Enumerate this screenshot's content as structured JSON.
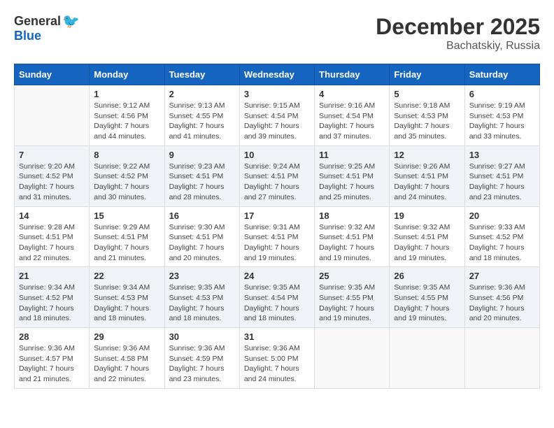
{
  "logo": {
    "general": "General",
    "blue": "Blue"
  },
  "title": "December 2025",
  "location": "Bachatskiy, Russia",
  "days_of_week": [
    "Sunday",
    "Monday",
    "Tuesday",
    "Wednesday",
    "Thursday",
    "Friday",
    "Saturday"
  ],
  "weeks": [
    {
      "shade": false,
      "days": [
        {
          "date": "",
          "info": ""
        },
        {
          "date": "1",
          "info": "Sunrise: 9:12 AM\nSunset: 4:56 PM\nDaylight: 7 hours\nand 44 minutes."
        },
        {
          "date": "2",
          "info": "Sunrise: 9:13 AM\nSunset: 4:55 PM\nDaylight: 7 hours\nand 41 minutes."
        },
        {
          "date": "3",
          "info": "Sunrise: 9:15 AM\nSunset: 4:54 PM\nDaylight: 7 hours\nand 39 minutes."
        },
        {
          "date": "4",
          "info": "Sunrise: 9:16 AM\nSunset: 4:54 PM\nDaylight: 7 hours\nand 37 minutes."
        },
        {
          "date": "5",
          "info": "Sunrise: 9:18 AM\nSunset: 4:53 PM\nDaylight: 7 hours\nand 35 minutes."
        },
        {
          "date": "6",
          "info": "Sunrise: 9:19 AM\nSunset: 4:53 PM\nDaylight: 7 hours\nand 33 minutes."
        }
      ]
    },
    {
      "shade": true,
      "days": [
        {
          "date": "7",
          "info": "Sunrise: 9:20 AM\nSunset: 4:52 PM\nDaylight: 7 hours\nand 31 minutes."
        },
        {
          "date": "8",
          "info": "Sunrise: 9:22 AM\nSunset: 4:52 PM\nDaylight: 7 hours\nand 30 minutes."
        },
        {
          "date": "9",
          "info": "Sunrise: 9:23 AM\nSunset: 4:51 PM\nDaylight: 7 hours\nand 28 minutes."
        },
        {
          "date": "10",
          "info": "Sunrise: 9:24 AM\nSunset: 4:51 PM\nDaylight: 7 hours\nand 27 minutes."
        },
        {
          "date": "11",
          "info": "Sunrise: 9:25 AM\nSunset: 4:51 PM\nDaylight: 7 hours\nand 25 minutes."
        },
        {
          "date": "12",
          "info": "Sunrise: 9:26 AM\nSunset: 4:51 PM\nDaylight: 7 hours\nand 24 minutes."
        },
        {
          "date": "13",
          "info": "Sunrise: 9:27 AM\nSunset: 4:51 PM\nDaylight: 7 hours\nand 23 minutes."
        }
      ]
    },
    {
      "shade": false,
      "days": [
        {
          "date": "14",
          "info": "Sunrise: 9:28 AM\nSunset: 4:51 PM\nDaylight: 7 hours\nand 22 minutes."
        },
        {
          "date": "15",
          "info": "Sunrise: 9:29 AM\nSunset: 4:51 PM\nDaylight: 7 hours\nand 21 minutes."
        },
        {
          "date": "16",
          "info": "Sunrise: 9:30 AM\nSunset: 4:51 PM\nDaylight: 7 hours\nand 20 minutes."
        },
        {
          "date": "17",
          "info": "Sunrise: 9:31 AM\nSunset: 4:51 PM\nDaylight: 7 hours\nand 19 minutes."
        },
        {
          "date": "18",
          "info": "Sunrise: 9:32 AM\nSunset: 4:51 PM\nDaylight: 7 hours\nand 19 minutes."
        },
        {
          "date": "19",
          "info": "Sunrise: 9:32 AM\nSunset: 4:51 PM\nDaylight: 7 hours\nand 19 minutes."
        },
        {
          "date": "20",
          "info": "Sunrise: 9:33 AM\nSunset: 4:52 PM\nDaylight: 7 hours\nand 18 minutes."
        }
      ]
    },
    {
      "shade": true,
      "days": [
        {
          "date": "21",
          "info": "Sunrise: 9:34 AM\nSunset: 4:52 PM\nDaylight: 7 hours\nand 18 minutes."
        },
        {
          "date": "22",
          "info": "Sunrise: 9:34 AM\nSunset: 4:53 PM\nDaylight: 7 hours\nand 18 minutes."
        },
        {
          "date": "23",
          "info": "Sunrise: 9:35 AM\nSunset: 4:53 PM\nDaylight: 7 hours\nand 18 minutes."
        },
        {
          "date": "24",
          "info": "Sunrise: 9:35 AM\nSunset: 4:54 PM\nDaylight: 7 hours\nand 18 minutes."
        },
        {
          "date": "25",
          "info": "Sunrise: 9:35 AM\nSunset: 4:55 PM\nDaylight: 7 hours\nand 19 minutes."
        },
        {
          "date": "26",
          "info": "Sunrise: 9:35 AM\nSunset: 4:55 PM\nDaylight: 7 hours\nand 19 minutes."
        },
        {
          "date": "27",
          "info": "Sunrise: 9:36 AM\nSunset: 4:56 PM\nDaylight: 7 hours\nand 20 minutes."
        }
      ]
    },
    {
      "shade": false,
      "days": [
        {
          "date": "28",
          "info": "Sunrise: 9:36 AM\nSunset: 4:57 PM\nDaylight: 7 hours\nand 21 minutes."
        },
        {
          "date": "29",
          "info": "Sunrise: 9:36 AM\nSunset: 4:58 PM\nDaylight: 7 hours\nand 22 minutes."
        },
        {
          "date": "30",
          "info": "Sunrise: 9:36 AM\nSunset: 4:59 PM\nDaylight: 7 hours\nand 23 minutes."
        },
        {
          "date": "31",
          "info": "Sunrise: 9:36 AM\nSunset: 5:00 PM\nDaylight: 7 hours\nand 24 minutes."
        },
        {
          "date": "",
          "info": ""
        },
        {
          "date": "",
          "info": ""
        },
        {
          "date": "",
          "info": ""
        }
      ]
    }
  ]
}
